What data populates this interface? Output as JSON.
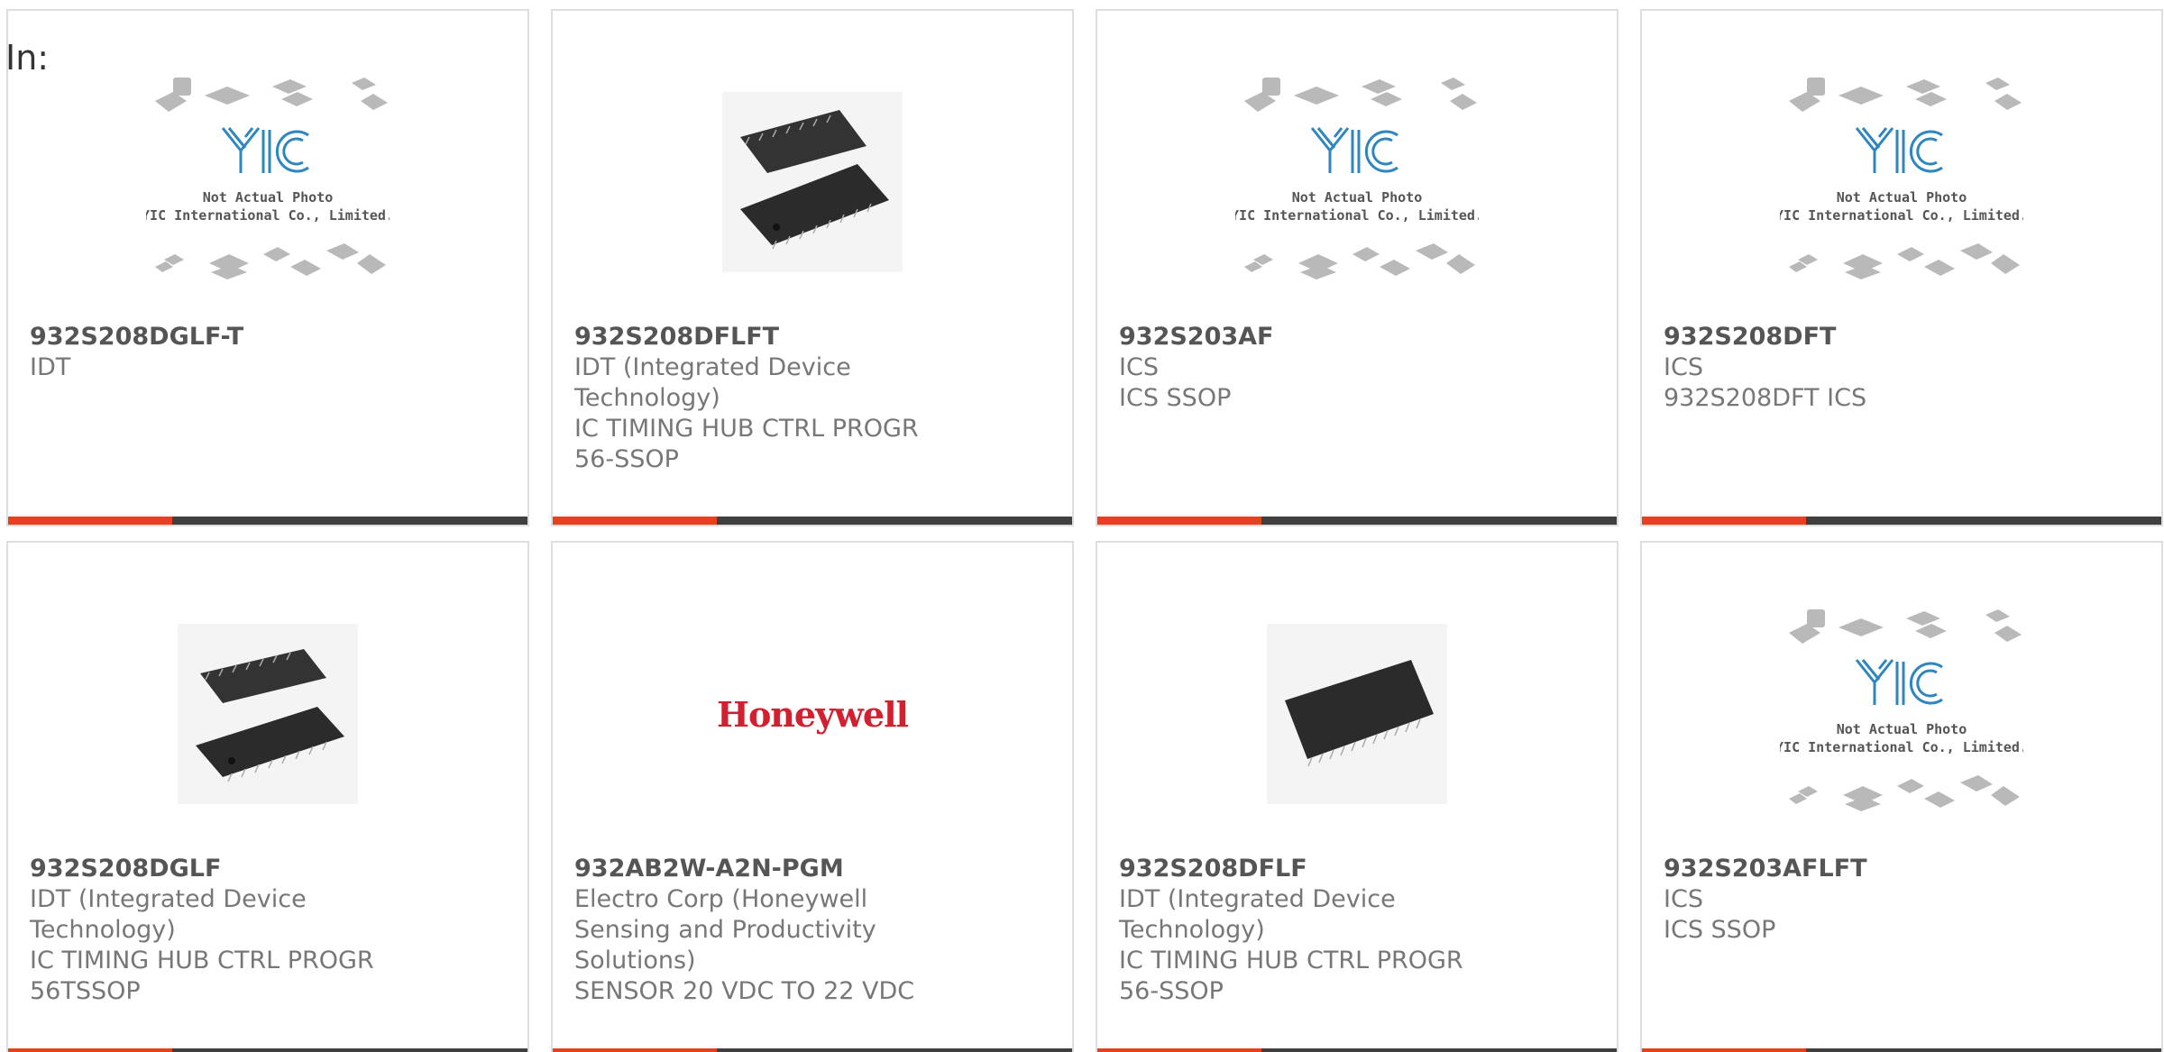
{
  "heading": "In:",
  "colors": {
    "accent": "#e8401c",
    "bar": "#3f3f3f",
    "border": "#dedede",
    "honeywell_red": "#d1202f",
    "yic_blue": "#2e86c1"
  },
  "placeholder": {
    "line1": "Not Actual Photo",
    "line2": "YIC International Co., Limited."
  },
  "products": [
    {
      "part": "932S208DGLF-T",
      "manufacturer": "IDT",
      "description": "",
      "image": "yic-placeholder"
    },
    {
      "part": "932S208DFLFT",
      "manufacturer": "IDT (Integrated Device Technology)",
      "description": "IC TIMING HUB CTRL PROGR 56-SSOP",
      "image": "dual-ssop-chip"
    },
    {
      "part": "932S203AF",
      "manufacturer": "ICS",
      "description": "ICS SSOP",
      "image": "yic-placeholder"
    },
    {
      "part": "932S208DFT",
      "manufacturer": "ICS",
      "description": "932S208DFT ICS",
      "image": "yic-placeholder"
    },
    {
      "part": "932S208DGLF",
      "manufacturer": "IDT (Integrated Device Technology)",
      "description": "IC TIMING HUB CTRL PROGR 56TSSOP",
      "image": "dual-tssop-chip"
    },
    {
      "part": "932AB2W-A2N-PGM",
      "manufacturer": "Electro Corp (Honeywell Sensing and Productivity Solutions)",
      "description": "SENSOR 20 VDC TO 22 VDC",
      "image": "honeywell-logo",
      "logo_text": "Honeywell"
    },
    {
      "part": "932S208DFLF",
      "manufacturer": "IDT (Integrated Device Technology)",
      "description": "IC TIMING HUB CTRL PROGR 56-SSOP",
      "image": "single-ssop-chip"
    },
    {
      "part": "932S203AFLFT",
      "manufacturer": "ICS",
      "description": "ICS SSOP",
      "image": "yic-placeholder"
    }
  ]
}
